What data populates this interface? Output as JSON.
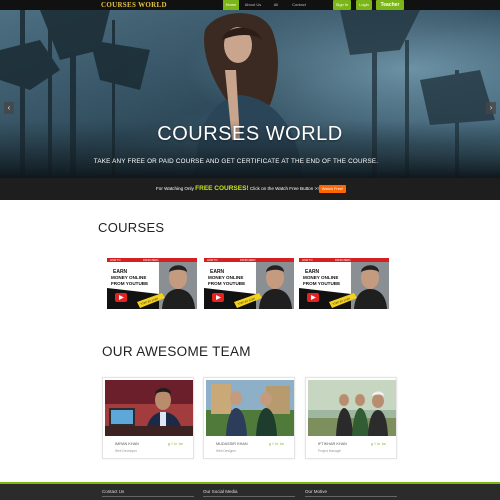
{
  "navbar": {
    "brand": "COURSES WORLD",
    "links": [
      "Home",
      "About Us",
      "All Courses",
      "Contact"
    ],
    "sign_in": "Sign In",
    "login": "Login",
    "teacher": "Teacher"
  },
  "hero": {
    "title": "COURSES WORLD",
    "subtitle": "TAKE ANY FREE OR PAID COURSE AND GET CERTIFICATE AT THE END OF THE COURSE.",
    "prev_icon": "chevron-left-icon",
    "next_icon": "chevron-right-icon",
    "slides": 3,
    "active_slide": 1
  },
  "promo": {
    "prefix": "For Watching Only ",
    "highlight": "FREE COURSES!",
    "suffix": " Click on the Watch Free Button >>",
    "button": "Watch Free!"
  },
  "courses": {
    "title": "COURSES",
    "items": [
      {
        "line1": "EARN",
        "line2": "MONEY ONLINE",
        "line3": "FROM YOUTUBE",
        "tag": "HOW TO",
        "tag2": "FROM ZERO",
        "tag3": "STEP BY STEP"
      },
      {
        "line1": "EARN",
        "line2": "MONEY ONLINE",
        "line3": "FROM YOUTUBE",
        "tag": "HOW TO",
        "tag2": "FROM ZERO",
        "tag3": "STEP BY STEP"
      },
      {
        "line1": "EARN",
        "line2": "MONEY ONLINE",
        "line3": "FROM YOUTUBE",
        "tag": "HOW TO",
        "tag2": "FROM ZERO",
        "tag3": "STEP BY STEP"
      }
    ]
  },
  "team": {
    "title": "OUR AWESOME TEAM",
    "members": [
      {
        "name": "IMRAN KHAN",
        "role": "Web Developer",
        "social": "g f in tw"
      },
      {
        "name": "MUDASSIR KHAN",
        "role": "Web Designer",
        "social": "g f in tw"
      },
      {
        "name": "IFTIKHAR KHAN",
        "role": "Project Manager",
        "social": "g f in tw"
      }
    ]
  },
  "footer": {
    "col1": "Contact Us",
    "col2": "Our Social Media",
    "col3": "Our Motive"
  },
  "colors": {
    "accent": "#7cb518",
    "promo_button": "#ff6600",
    "promo_highlight": "#c8e61e",
    "brand": "#e6c341",
    "dark": "#111111"
  }
}
